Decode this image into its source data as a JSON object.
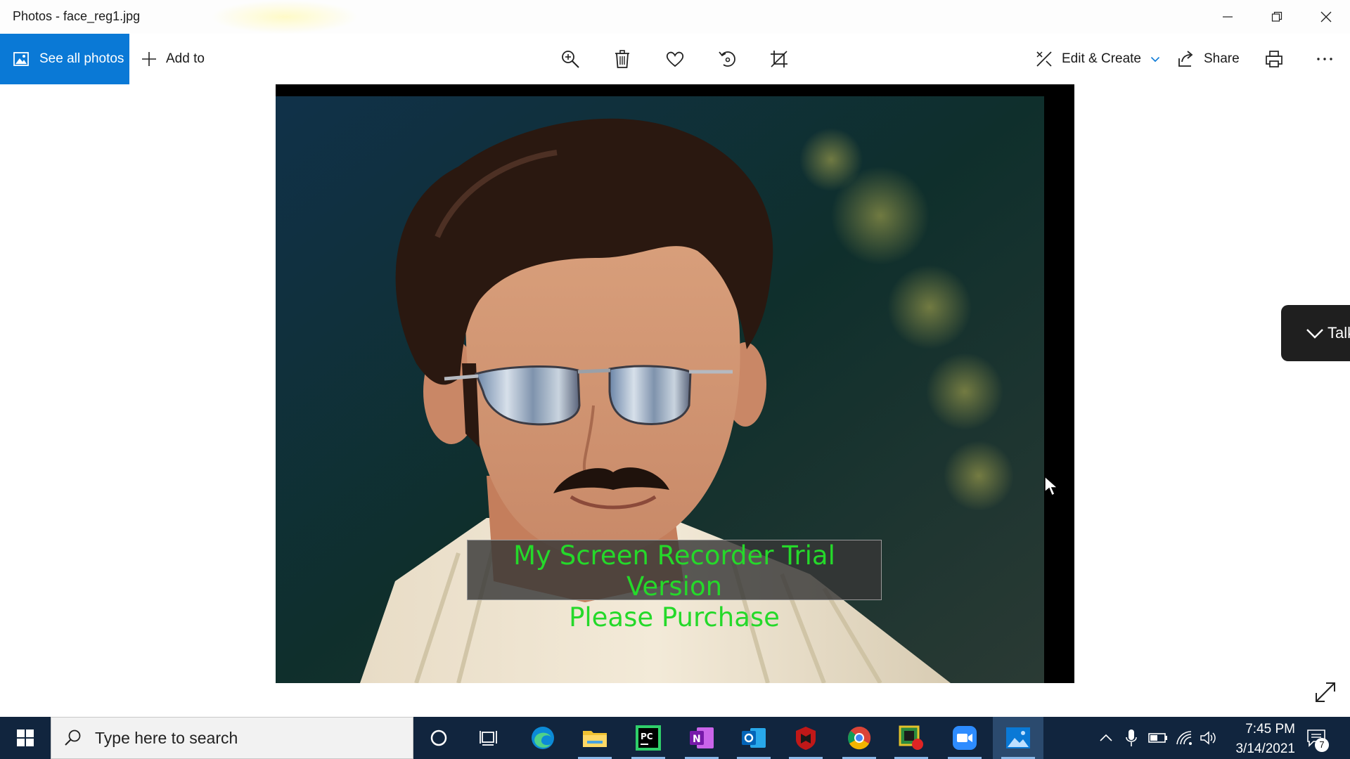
{
  "window": {
    "title": "Photos - face_reg1.jpg"
  },
  "toolbar": {
    "see_all_label": "See all photos",
    "add_to_label": "Add to",
    "edit_create_label": "Edit & Create",
    "share_label": "Share",
    "icons": [
      "zoom-icon",
      "delete-icon",
      "favorite-icon",
      "rotate-icon",
      "crop-icon",
      "print-icon",
      "more-icon"
    ]
  },
  "photo": {
    "watermark_line1": "My Screen Recorder Trial Version",
    "watermark_line2": "Please Purchase"
  },
  "side_tab": {
    "label": "Talk"
  },
  "taskbar": {
    "search_placeholder": "Type here to search",
    "apps": [
      "cortana",
      "task-view",
      "edge",
      "file-explorer",
      "pycharm",
      "onenote",
      "outlook",
      "mcafee",
      "chrome",
      "screen-recorder",
      "zoom",
      "photos"
    ],
    "time": "7:45 PM",
    "date": "3/14/2021",
    "notification_count": "7"
  },
  "colors": {
    "accent": "#0a79d6",
    "taskbar": "#11253e",
    "watermark_text": "#25d92a"
  }
}
